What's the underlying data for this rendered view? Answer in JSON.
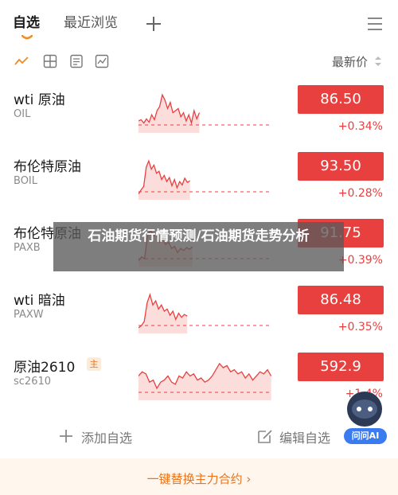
{
  "tabs": {
    "active": "自选",
    "recent": "最近浏览"
  },
  "toolbar": {
    "sort_label": "最新价",
    "icons": [
      "line-chart-icon",
      "grid-icon",
      "list-icon",
      "chart-box-icon"
    ]
  },
  "colors": {
    "up": "#e8403f",
    "accent": "#e8741c",
    "ai": "#3b7bf2"
  },
  "rows": [
    {
      "name": "wti 原油",
      "code": "OIL",
      "price": "86.50",
      "change": "+0.34%",
      "badge": ""
    },
    {
      "name": "布伦特原油",
      "code": "BOIL",
      "price": "93.50",
      "change": "+0.28%",
      "badge": ""
    },
    {
      "name": "布伦特原油",
      "code": "PAXB",
      "price": "91.75",
      "change": "+0.39%",
      "badge": ""
    },
    {
      "name": "wti 暗油",
      "code": "PAXW",
      "price": "86.48",
      "change": "+0.35%",
      "badge": ""
    },
    {
      "name": "原油2610",
      "code": "sc2610",
      "price": "592.9",
      "change": "+1.4%",
      "badge": "主"
    }
  ],
  "actions": {
    "add": "添加自选",
    "edit": "编辑自选"
  },
  "banner": {
    "text": "一键替换主力合约 ›"
  },
  "ai": {
    "label": "问问AI"
  },
  "overlay": {
    "title": "石油期货行情预测/石油期货走势分析"
  }
}
